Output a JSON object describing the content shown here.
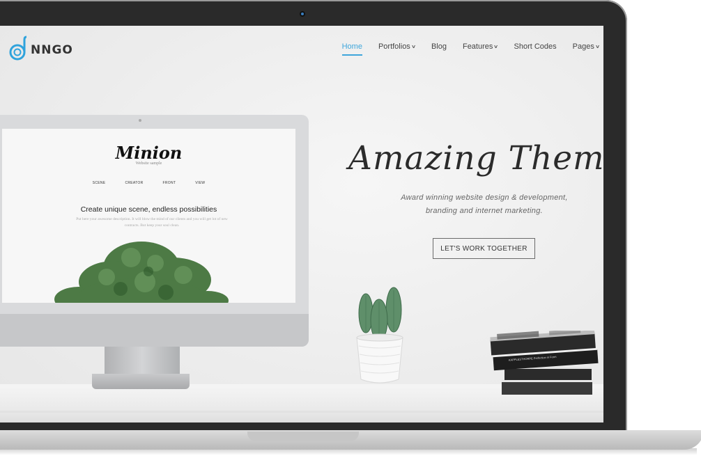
{
  "brand": {
    "logo_text": "NNGO",
    "accent_color": "#3ea6db"
  },
  "nav": {
    "items": [
      {
        "label": "Home",
        "active": true,
        "dropdown": false
      },
      {
        "label": "Portfolios",
        "active": false,
        "dropdown": true
      },
      {
        "label": "Blog",
        "active": false,
        "dropdown": false
      },
      {
        "label": "Features",
        "active": false,
        "dropdown": true
      },
      {
        "label": "Short Codes",
        "active": false,
        "dropdown": false
      },
      {
        "label": "Pages",
        "active": false,
        "dropdown": true
      }
    ],
    "dropdown_icon": "chevron-down-icon"
  },
  "hero": {
    "title": "Amazing Them",
    "subtitle_line1": "Award winning website design & development,",
    "subtitle_line2": "branding and internet marketing.",
    "cta_label": "LET'S WORK TOGETHER"
  },
  "mockup": {
    "title": "Minion",
    "subtitle": "Website sample",
    "menu": [
      "SCENE",
      "CREATOR",
      "FRONT",
      "VIEW"
    ],
    "headline": "Create unique scene, endless possibilities",
    "description": "Put here your awesome description. It will blow the mind of our clients and you will get lot of new contracts. But keep your soul clean."
  },
  "books": {
    "spine_1": "KAPPLESTHORPE Perfection in Form"
  }
}
